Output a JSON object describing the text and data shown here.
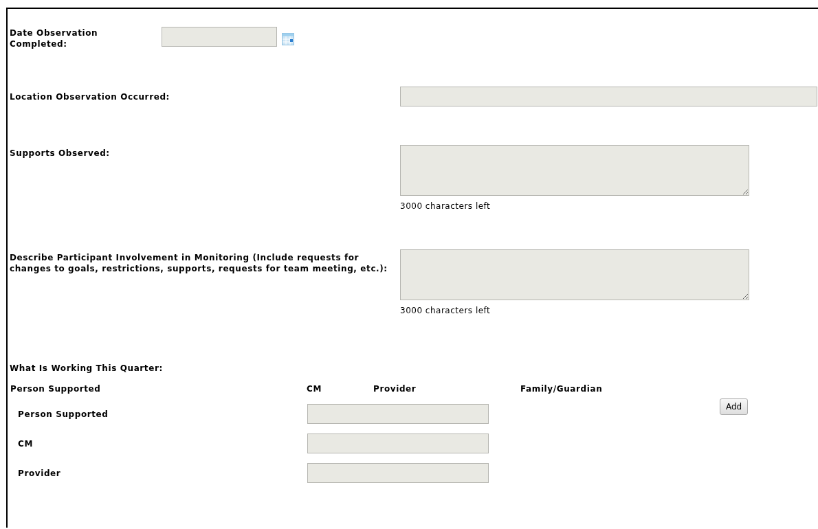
{
  "fields": [
    {
      "kind": "date",
      "label": "Date Observation Completed:"
    },
    {
      "kind": "text",
      "label": "Location Observation Occurred:"
    },
    {
      "kind": "textarea",
      "label": "Supports Observed:",
      "counter": "3000 characters left"
    },
    {
      "kind": "textarea",
      "label": "Describe Participant Involvement in Monitoring (Include requests for changes to goals, restrictions, supports, requests for team meeting, etc.):",
      "counter": "3000 characters left"
    }
  ],
  "working": {
    "title": "What Is Working This Quarter:",
    "columns": [
      "Person Supported",
      "CM",
      "Provider",
      "Family/Guardian"
    ],
    "rows": [
      "Person Supported",
      "CM",
      "Provider"
    ],
    "add_button": "Add"
  }
}
